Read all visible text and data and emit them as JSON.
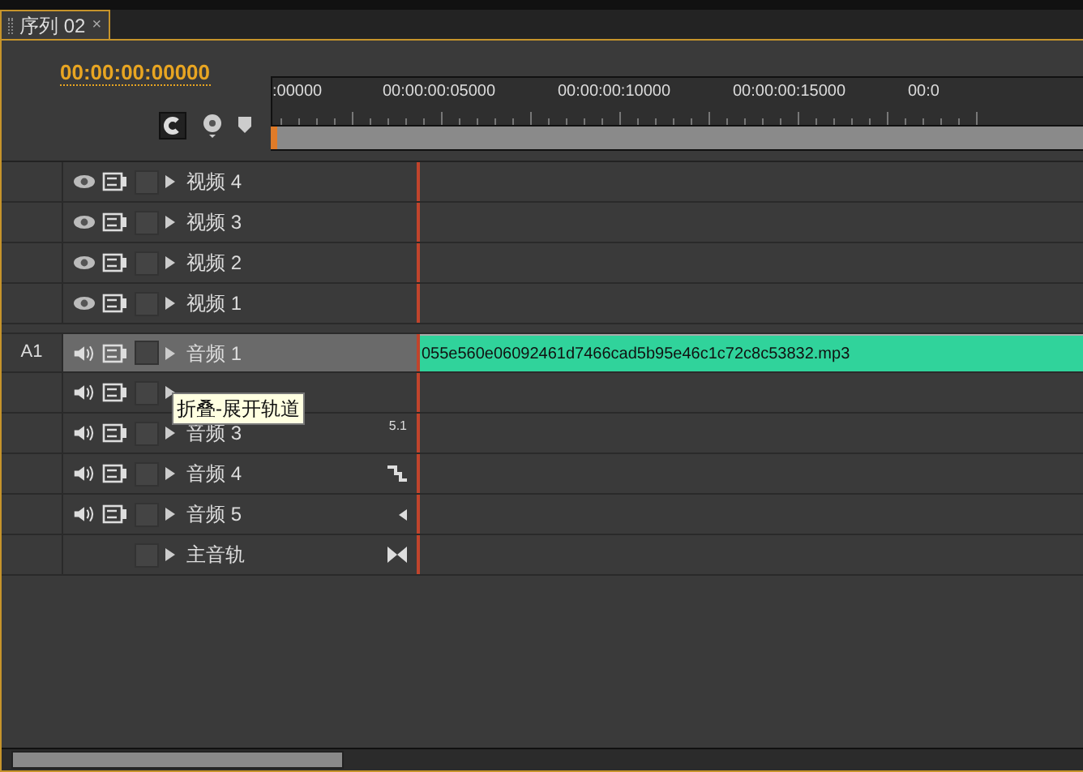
{
  "tab": {
    "title": "序列 02",
    "close": "×",
    "selected": true
  },
  "timecode": "00:00:00:00000",
  "ruler": {
    "labels": [
      ":00000",
      "00:00:00:05000",
      "00:00:00:10000",
      "00:00:00:15000",
      "00:0"
    ]
  },
  "tracks": [
    {
      "kind": "video",
      "name": "视频 4",
      "selected": false
    },
    {
      "kind": "video",
      "name": "视频 3",
      "selected": false
    },
    {
      "kind": "video",
      "name": "视频 2",
      "selected": false
    },
    {
      "kind": "video",
      "name": "视频 1",
      "selected": false
    },
    {
      "kind": "audio",
      "target": "A1",
      "name": "音频 1",
      "selected": true,
      "clip": "055e560e06092461d7466cad5b95e46c1c72c8c53832.mp3"
    },
    {
      "kind": "audio",
      "selected": false,
      "tooltip": "折叠-展开轨道"
    },
    {
      "kind": "audio",
      "name": "音频 3",
      "selected": false,
      "channel": "5.1"
    },
    {
      "kind": "audio",
      "name": "音频 4",
      "selected": false,
      "channel_mark": {
        "kind": "stereo"
      }
    },
    {
      "kind": "audio",
      "name": "音频 5",
      "selected": false,
      "channel_mark": {
        "kind": "mono"
      }
    },
    {
      "kind": "master",
      "name": "主音轨",
      "selected": false,
      "channel_mark": {
        "kind": "master"
      }
    }
  ]
}
